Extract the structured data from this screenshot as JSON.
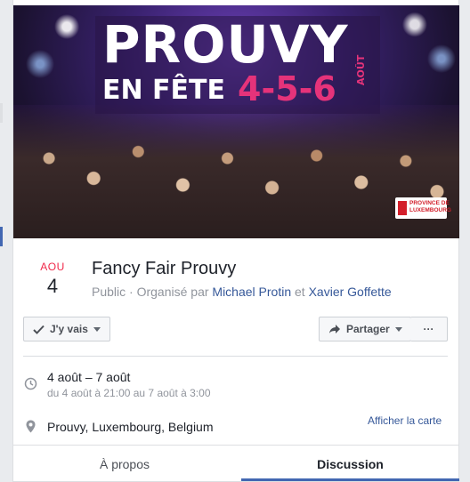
{
  "cover": {
    "poster_title": "PROUVY",
    "poster_subtitle": "EN FÊTE",
    "poster_dates": "4-5-6",
    "poster_month": "AOÛT",
    "logo_text": "PROVINCE DE\nLUXEMBOURG"
  },
  "event": {
    "month": "AOU",
    "day": "4",
    "title": "Fancy Fair Prouvy",
    "visibility": "Public",
    "organized_by": " · Organisé par ",
    "organizer_1": "Michael Protin",
    "conjunction": " et ",
    "organizer_2": "Xavier Goffette"
  },
  "actions": {
    "going_label": "J'y vais",
    "share_label": "Partager",
    "more_label": "···"
  },
  "details": {
    "time_main": "4 août – 7 août",
    "time_sub": "du 4 août à 21:00 au 7 août à 3:00",
    "location": "Prouvy, Luxembourg, Belgium",
    "map_link": "Afficher la carte"
  },
  "tabs": [
    {
      "label": "À propos"
    },
    {
      "label": "Discussion"
    }
  ],
  "colors": {
    "accent": "#4267b2",
    "link": "#365899",
    "date_month": "#f02849",
    "poster_pink": "#e5337a"
  },
  "icons": {
    "going": "check-icon",
    "share": "share-arrow-icon",
    "time": "clock-icon",
    "location": "map-pin-icon"
  }
}
